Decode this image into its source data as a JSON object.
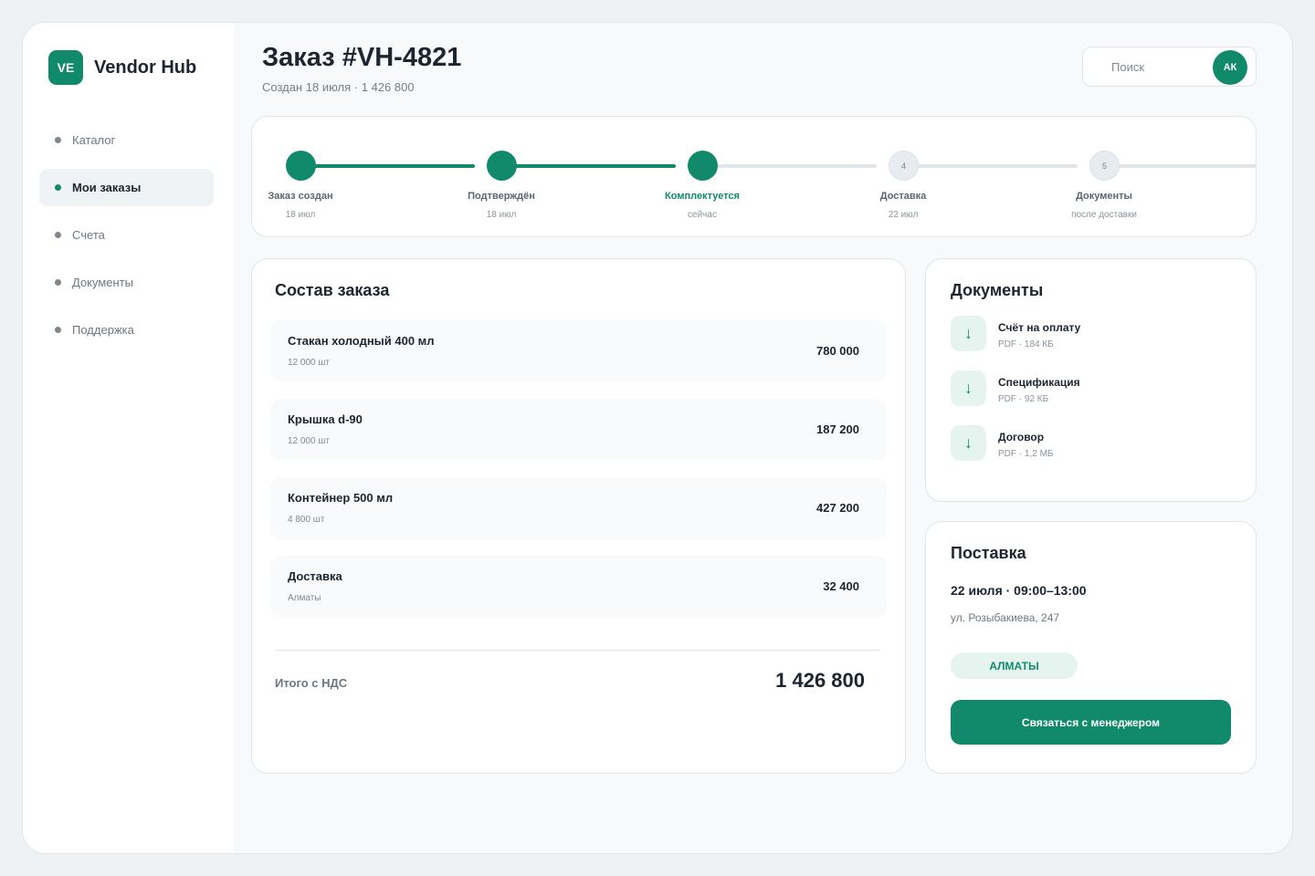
{
  "brand": {
    "logo": "VE",
    "name": "Vendor Hub"
  },
  "nav": [
    {
      "label": "Каталог",
      "active": false
    },
    {
      "label": "Мои заказы",
      "active": true
    },
    {
      "label": "Счета",
      "active": false
    },
    {
      "label": "Документы",
      "active": false
    },
    {
      "label": "Поддержка",
      "active": false
    }
  ],
  "header": {
    "title": "Заказ #VH-4821",
    "subtitle": "Создан 18 июля · 1 426 800",
    "search_placeholder": "Поиск",
    "avatar_initials": "АК"
  },
  "steps": [
    {
      "number": "",
      "label": "Заказ создан",
      "date": "18 июл",
      "state": "done"
    },
    {
      "number": "",
      "label": "Подтверждён",
      "date": "18 июл",
      "state": "done"
    },
    {
      "number": "",
      "label": "Комплектуется",
      "date": "сейчас",
      "state": "current"
    },
    {
      "number": "4",
      "label": "Доставка",
      "date": "22 июл",
      "state": "todo"
    },
    {
      "number": "5",
      "label": "Документы",
      "date": "после доставки",
      "state": "todo"
    }
  ],
  "order": {
    "title": "Состав заказа",
    "items": [
      {
        "name": "Стакан холодный 400 мл",
        "qty": "12 000 шт",
        "price": "780 000"
      },
      {
        "name": "Крышка d-90",
        "qty": "12 000 шт",
        "price": "187 200"
      },
      {
        "name": "Контейнер 500 мл",
        "qty": "4 800 шт",
        "price": "427 200"
      },
      {
        "name": "Доставка",
        "qty": "Алматы",
        "price": "32 400"
      }
    ],
    "total_label": "Итого с НДС",
    "total_value": "1 426 800"
  },
  "documents": {
    "title": "Документы",
    "icon": "download-arrow-icon",
    "items": [
      {
        "name": "Счёт на оплату",
        "meta": "PDF · 184 КБ"
      },
      {
        "name": "Спецификация",
        "meta": "PDF · 92 КБ"
      },
      {
        "name": "Договор",
        "meta": "PDF · 1,2 МБ"
      }
    ]
  },
  "delivery": {
    "title": "Поставка",
    "time": "22 июля · 09:00–13:00",
    "address": "ул. Розыбакиева, 247",
    "city": "АЛМАТЫ",
    "button_label": "Связаться с менеджером"
  },
  "colors": {
    "accent": "#118a6c",
    "accent_light": "#e6f4ef",
    "track": "#e1e6ea"
  }
}
